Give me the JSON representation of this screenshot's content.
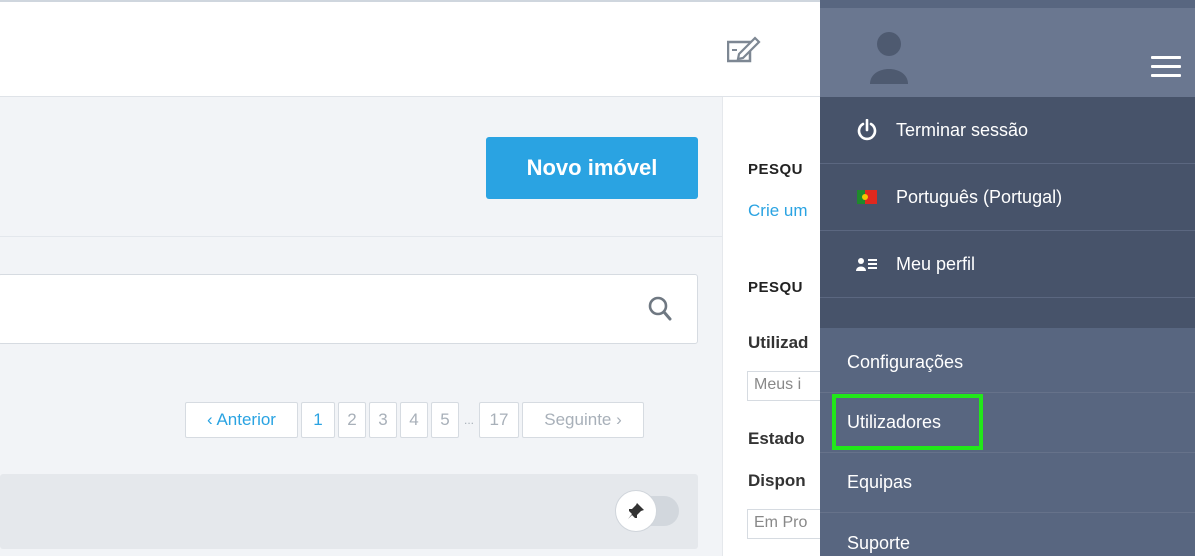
{
  "header": {
    "edit_icon": "edit-note-icon"
  },
  "main": {
    "new_property_button": "Novo imóvel",
    "search": {
      "placeholder": "",
      "icon": "search-icon"
    },
    "pagination": {
      "previous": "‹ Anterior",
      "pages": [
        "1",
        "2",
        "3",
        "4",
        "5"
      ],
      "ellipsis": "...",
      "last": "17",
      "next": "Seguinte ›"
    },
    "pin_toggle_icon": "pin-icon"
  },
  "right_pane": {
    "section1_heading": "PESQU",
    "section1_link": "Crie um",
    "section2_heading": "PESQU",
    "user_label": "Utilizad",
    "user_value": "Meus i",
    "state_label": "Estado",
    "availability_label": "Dispon",
    "availability_value": "Em Pro"
  },
  "user_menu": {
    "avatar_icon": "avatar-placeholder-icon",
    "menu_icon": "hamburger-menu-icon",
    "logout": {
      "label": "Terminar sessão",
      "icon": "power-icon"
    },
    "language": {
      "label": "Português (Portugal)",
      "icon": "portugal-flag-icon"
    },
    "profile": {
      "label": "Meu perfil",
      "icon": "profile-card-icon"
    },
    "links": [
      "Configurações",
      "Utilizadores",
      "Equipas",
      "Suporte"
    ]
  },
  "colors": {
    "accent": "#2aa3e2",
    "panel": "#586680",
    "panel_dark": "#47536a",
    "highlight": "#22e81a"
  }
}
